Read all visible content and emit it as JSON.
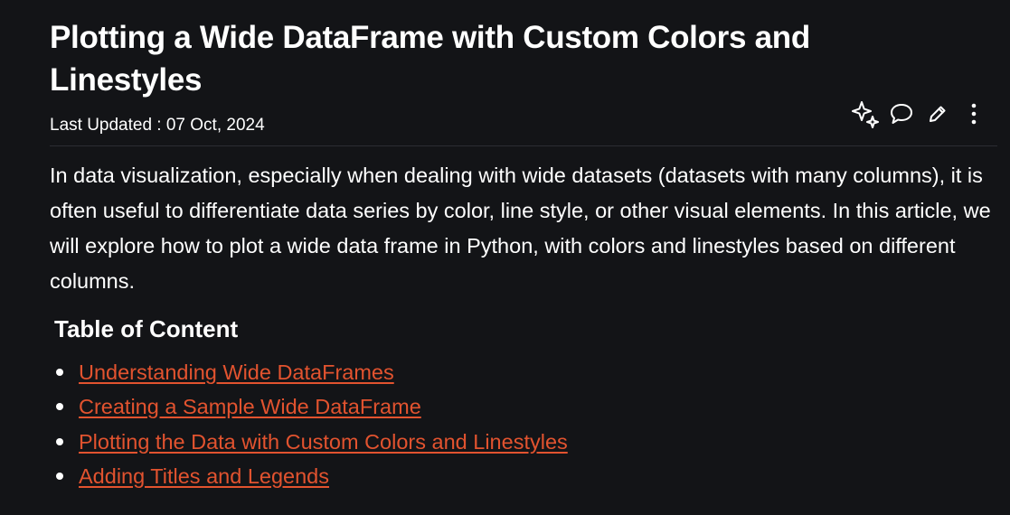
{
  "article": {
    "title": "Plotting a Wide DataFrame with Custom Colors and Linestyles",
    "last_updated": "Last Updated : 07 Oct, 2024",
    "intro": "In data visualization, especially when dealing with wide datasets (datasets with many columns), it is often useful to differentiate data series by color, line style, or other visual elements. In this article, we will explore how to plot a wide data frame in Python, with colors and linestyles based on different columns."
  },
  "actions": [
    {
      "icon": "sparkle-ai-icon"
    },
    {
      "icon": "comment-icon"
    },
    {
      "icon": "edit-pencil-icon"
    },
    {
      "icon": "more-vertical-icon"
    }
  ],
  "toc": {
    "heading": "Table of Content",
    "items": [
      {
        "label": "Understanding Wide DataFrames"
      },
      {
        "label": "Creating a Sample Wide DataFrame"
      },
      {
        "label": "Plotting the Data with Custom Colors and Linestyles"
      },
      {
        "label": "Adding Titles and Legends"
      }
    ]
  },
  "colors": {
    "background": "#131417",
    "text": "#ffffff",
    "link": "#e2532f",
    "divider": "#2b2d33"
  }
}
